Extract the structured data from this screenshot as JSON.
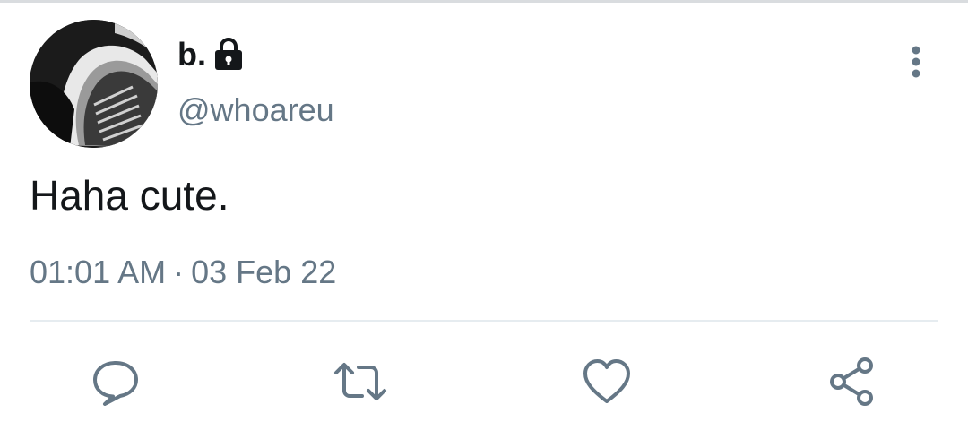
{
  "tweet": {
    "display_name": "b.",
    "handle": "@whoareu",
    "text": "Haha cute.",
    "time": "01:01 AM",
    "separator": "·",
    "date": "03 Feb 22",
    "protected_icon": "lock-icon"
  },
  "actions": {
    "reply_icon": "comment-icon",
    "retweet_icon": "retweet-icon",
    "like_icon": "heart-icon",
    "share_icon": "share-icon",
    "more_icon": "more-vertical-icon"
  },
  "colors": {
    "text_primary": "#14171a",
    "text_secondary": "#657786",
    "divider": "#e6ecf0"
  }
}
